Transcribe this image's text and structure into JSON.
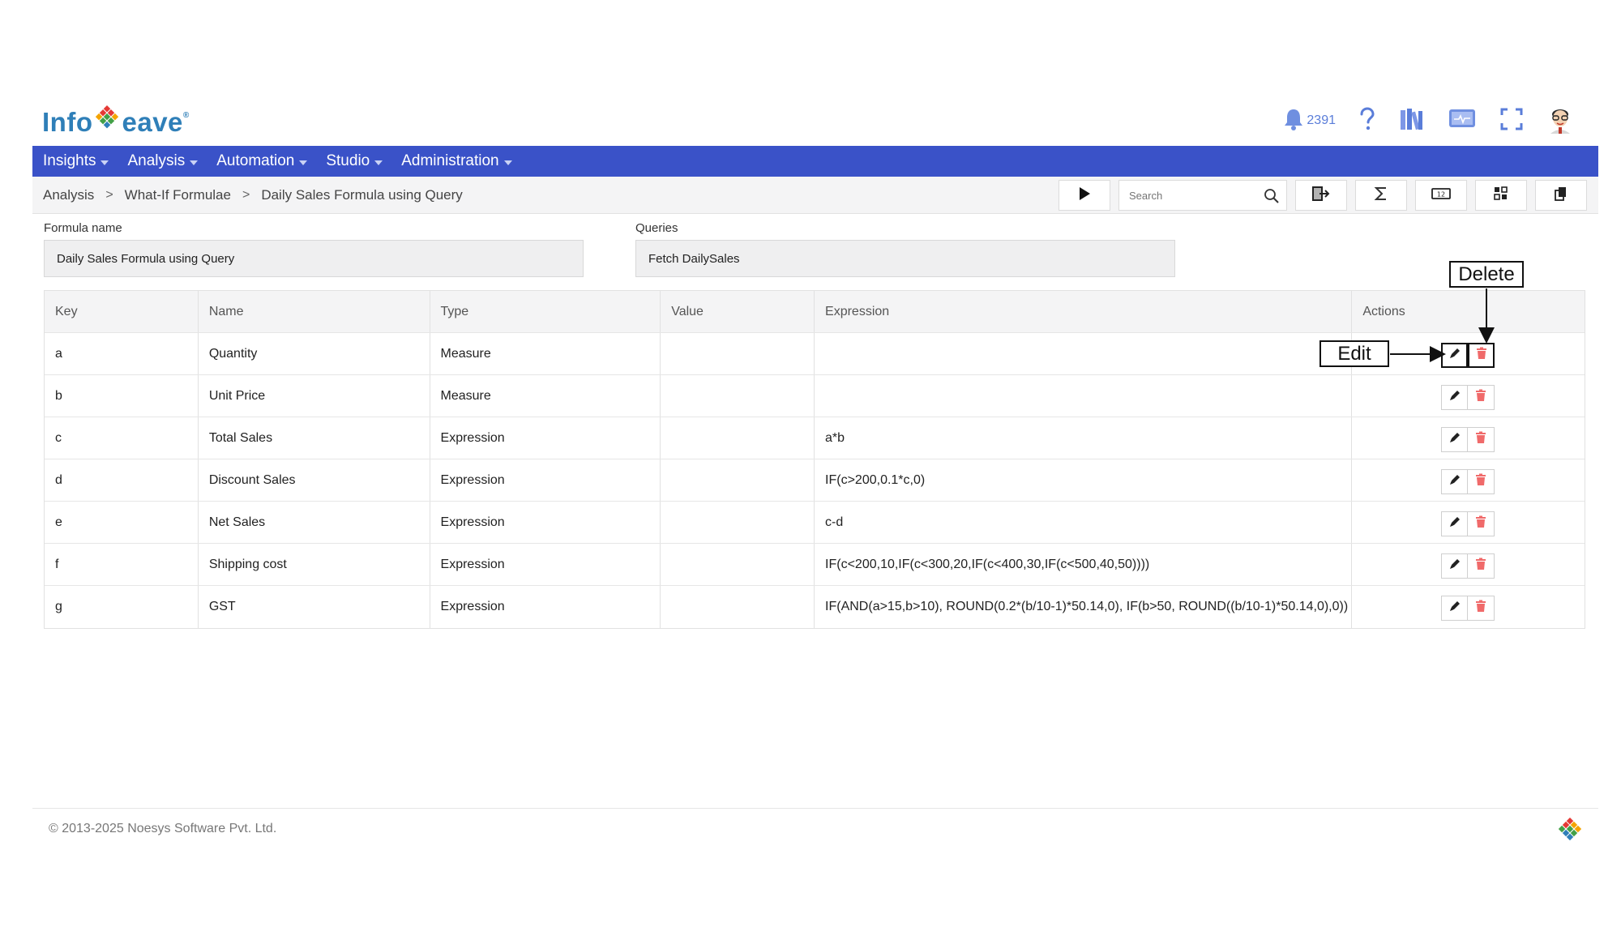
{
  "brand": {
    "logo_left": "Info",
    "logo_right": "eave",
    "reg": "®"
  },
  "header": {
    "notification_count": "2391"
  },
  "nav": {
    "items": [
      {
        "label": "Insights"
      },
      {
        "label": "Analysis"
      },
      {
        "label": "Automation"
      },
      {
        "label": "Studio"
      },
      {
        "label": "Administration"
      }
    ]
  },
  "breadcrumb": {
    "items": [
      "Analysis",
      "What-If Formulae",
      "Daily Sales Formula using Query"
    ]
  },
  "toolbar": {
    "search_placeholder": "Search"
  },
  "form": {
    "formula_name_label": "Formula name",
    "formula_name_value": "Daily Sales Formula using Query",
    "queries_label": "Queries",
    "queries_value": "Fetch DailySales"
  },
  "table": {
    "headers": [
      "Key",
      "Name",
      "Type",
      "Value",
      "Expression",
      "Actions"
    ],
    "rows": [
      {
        "key": "a",
        "name": "Quantity",
        "type": "Measure",
        "value": "",
        "expression": ""
      },
      {
        "key": "b",
        "name": "Unit Price",
        "type": "Measure",
        "value": "",
        "expression": ""
      },
      {
        "key": "c",
        "name": "Total Sales",
        "type": "Expression",
        "value": "",
        "expression": "a*b"
      },
      {
        "key": "d",
        "name": "Discount Sales",
        "type": "Expression",
        "value": "",
        "expression": "IF(c>200,0.1*c,0)"
      },
      {
        "key": "e",
        "name": "Net Sales",
        "type": "Expression",
        "value": "",
        "expression": "c-d"
      },
      {
        "key": "f",
        "name": "Shipping cost",
        "type": "Expression",
        "value": "",
        "expression": "IF(c<200,10,IF(c<300,20,IF(c<400,30,IF(c<500,40,50))))"
      },
      {
        "key": "g",
        "name": "GST",
        "type": "Expression",
        "value": "",
        "expression": "IF(AND(a>15,b>10), ROUND(0.2*(b/10-1)*50.14,0), IF(b>50, ROUND((b/10-1)*50.14,0),0))"
      }
    ]
  },
  "callouts": {
    "edit": "Edit",
    "delete": "Delete"
  },
  "footer": {
    "copyright": "© 2013-2025 Noesys Software Pvt. Ltd."
  },
  "colors": {
    "nav_bg": "#3a52c8",
    "brand_blue": "#2f7fb8",
    "delete_red": "#f06a6a",
    "icon_blue": "#5a7dd9"
  }
}
